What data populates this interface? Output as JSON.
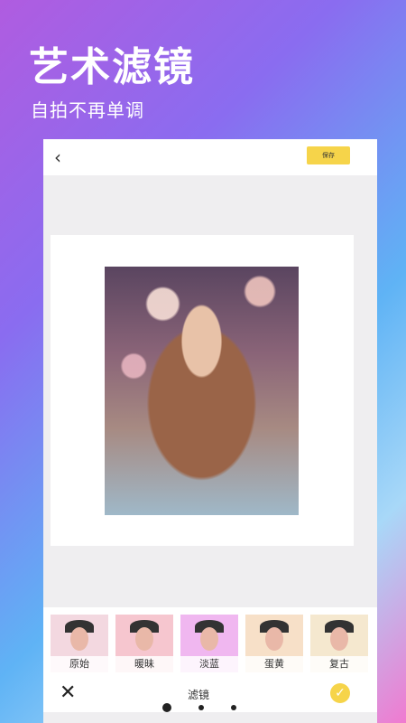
{
  "hero": {
    "title": "艺术滤镜",
    "subtitle": "自拍不再单调"
  },
  "editor": {
    "back_icon": "chevron-left-icon",
    "save_label": "保存",
    "accent": "#f6d44a"
  },
  "filters": [
    {
      "label": "原始",
      "tint": "#f3d8e0"
    },
    {
      "label": "暖昧",
      "tint": "#f6c6cf"
    },
    {
      "label": "淡蓝",
      "tint": "#f0b7f0"
    },
    {
      "label": "蛋黄",
      "tint": "#f7e0c8"
    },
    {
      "label": "复古",
      "tint": "#f5e8cf"
    }
  ],
  "bottom": {
    "label": "滤镜",
    "close_icon": "close-icon",
    "confirm_icon": "check-icon"
  },
  "pager": {
    "total": 3,
    "active_index": 0
  }
}
